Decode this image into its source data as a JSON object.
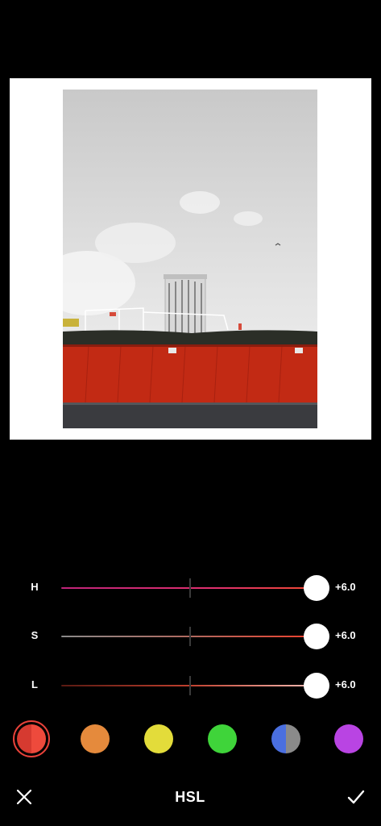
{
  "photo": {
    "description_icon": "photo-preview"
  },
  "hsl": {
    "sliders": [
      {
        "label": "H",
        "value_text": "+6.0",
        "value": 6.0,
        "range": [
          -6,
          6
        ]
      },
      {
        "label": "S",
        "value_text": "+6.0",
        "value": 6.0,
        "range": [
          -6,
          6
        ]
      },
      {
        "label": "L",
        "value_text": "+6.0",
        "value": 6.0,
        "range": [
          -6,
          6
        ]
      }
    ],
    "swatches": [
      {
        "name": "red",
        "color": "#e8423a",
        "selected": true
      },
      {
        "name": "orange",
        "color": "#e58a3c",
        "selected": false
      },
      {
        "name": "yellow",
        "color": "#e3dc3a",
        "selected": false
      },
      {
        "name": "green",
        "color": "#3fd43a",
        "selected": false
      },
      {
        "name": "blue",
        "color": "#4a6fe0",
        "selected": false
      },
      {
        "name": "purple",
        "color": "#b944e3",
        "selected": false
      }
    ]
  },
  "bottom_bar": {
    "title": "HSL",
    "close_icon": "close-icon",
    "confirm_icon": "check-icon"
  }
}
